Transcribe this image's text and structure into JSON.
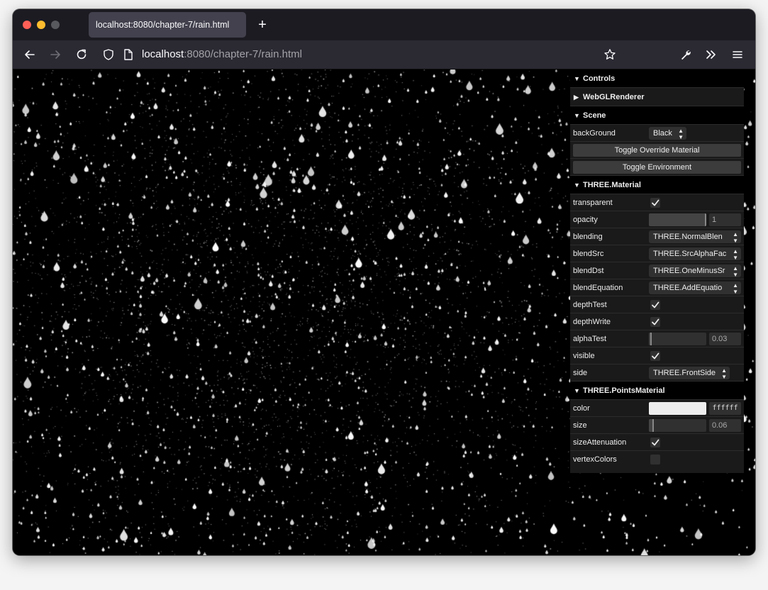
{
  "browser": {
    "tab_title": "localhost:8080/chapter-7/rain.html",
    "new_tab_label": "+",
    "url_host": "localhost",
    "url_rest": ":8080/chapter-7/rain.html"
  },
  "gui": {
    "controls_label": "Controls",
    "webgl_label": "WebGLRenderer",
    "scene": {
      "title": "Scene",
      "background_label": "backGround",
      "background_value": "Black",
      "toggle_override": "Toggle Override Material",
      "toggle_env": "Toggle Environment"
    },
    "material": {
      "title": "THREE.Material",
      "transparent_label": "transparent",
      "transparent": true,
      "opacity_label": "opacity",
      "opacity": 1,
      "opacity_text": "1",
      "blending_label": "blending",
      "blending_value": "THREE.NormalBlen",
      "blendsrc_label": "blendSrc",
      "blendsrc_value": "THREE.SrcAlphaFac",
      "blenddst_label": "blendDst",
      "blenddst_value": "THREE.OneMinusSr",
      "blendeq_label": "blendEquation",
      "blendeq_value": "THREE.AddEquatio",
      "depthtest_label": "depthTest",
      "depthtest": true,
      "depthwrite_label": "depthWrite",
      "depthwrite": true,
      "alphatest_label": "alphaTest",
      "alphatest": 0.03,
      "alphatest_text": "0.03",
      "visible_label": "visible",
      "visible": true,
      "side_label": "side",
      "side_value": "THREE.FrontSide"
    },
    "points": {
      "title": "THREE.PointsMaterial",
      "color_label": "color",
      "color": "#eeeeee",
      "color_hex": "ffffff",
      "size_label": "size",
      "size": 0.06,
      "size_text": "0.06",
      "sizeatt_label": "sizeAttenuation",
      "sizeatt": true,
      "vertexcolors_label": "vertexColors",
      "vertexcolors": false
    }
  },
  "colors": {
    "window_bg": "#1c1b22",
    "toolbar_bg": "#2b2a33",
    "scene_bg": "#000000",
    "gui_bg": "#1a1a1a"
  }
}
